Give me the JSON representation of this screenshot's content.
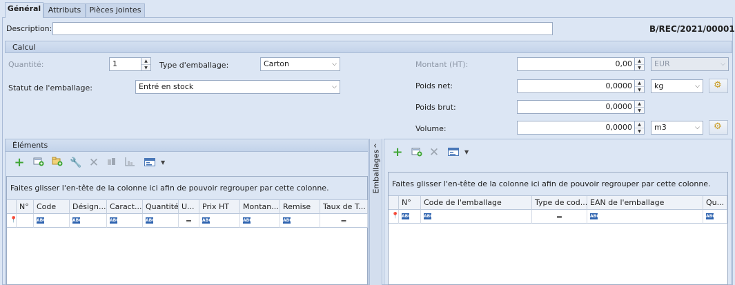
{
  "tabs": [
    {
      "label": "Général",
      "active": true
    },
    {
      "label": "Attributs",
      "active": false
    },
    {
      "label": "Pièces jointes",
      "active": false
    }
  ],
  "header": {
    "description_label": "Description:",
    "description_value": "",
    "document_number": "B/REC/2021/00001"
  },
  "calcul": {
    "title": "Calcul",
    "quantity_label": "Quantité:",
    "quantity_value": "1",
    "packaging_type_label": "Type d'emballage:",
    "packaging_type_value": "Carton",
    "packaging_status_label": "Statut de l'emballage:",
    "packaging_status_value": "Entré en stock",
    "amount_label": "Montant (HT):",
    "amount_value": "0,00",
    "currency_value": "EUR",
    "net_weight_label": "Poids net:",
    "net_weight_value": "0,0000",
    "net_weight_unit": "kg",
    "gross_weight_label": "Poids brut:",
    "gross_weight_value": "0,0000",
    "volume_label": "Volume:",
    "volume_value": "0,0000",
    "volume_unit": "m3"
  },
  "elements": {
    "title": "Éléments",
    "group_hint": "Faites glisser l'en-tête de la colonne ici afin de pouvoir regrouper par cette colonne.",
    "columns": [
      "N°",
      "Code",
      "Désign...",
      "Caract...",
      "Quantité",
      "U...",
      "Prix HT",
      "Montan...",
      "Remise",
      "Taux de T..."
    ]
  },
  "splitter": {
    "label": "Emballages",
    "arrow": "‹"
  },
  "packagings": {
    "group_hint": "Faites glisser l'en-tête de la colonne ici afin de pouvoir regrouper par cette colonne.",
    "columns": [
      "N°",
      "Code de l'emballage",
      "Type de cod...",
      "EAN de l'emballage",
      "Qu..."
    ]
  },
  "filter_row": {
    "abc_label": "ABC",
    "equals_label": "="
  },
  "icons": {
    "add": "plus-icon",
    "add_from_list": "add-from-list-icon",
    "add_folder": "add-folder-icon",
    "edit": "wrench-icon",
    "delete": "delete-icon",
    "details": "details-icon",
    "chart": "chart-icon",
    "view": "view-options-icon",
    "settings": "settings-icon",
    "pin": "pin-icon"
  },
  "colors": {
    "background": "#dce6f4",
    "add_green": "#3fa535",
    "border": "#a9bbd6",
    "abc_blue": "#2f64b0"
  }
}
